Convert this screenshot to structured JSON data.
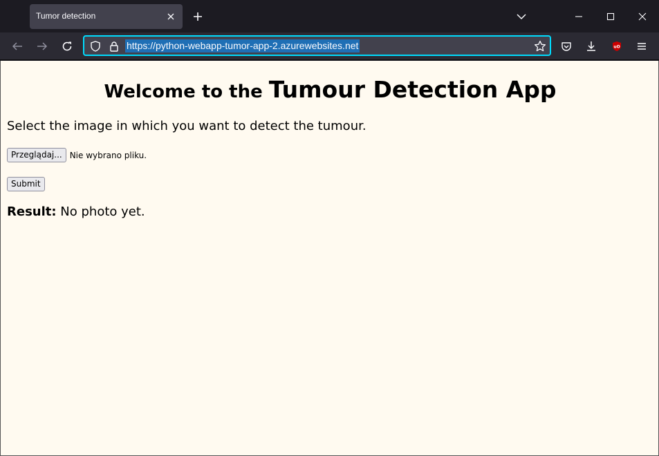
{
  "browser": {
    "tab_title": "Tumor detection",
    "url": "https://python-webapp-tumor-app-2.azurewebsites.net",
    "colors": {
      "tabbar": "#1c1b22",
      "navbar": "#2b2a33",
      "urlbar": "#42414d",
      "focus_ring": "#00ddff",
      "ublock_red": "#cc0000"
    },
    "icons": [
      "close-icon",
      "plus-icon",
      "chevron-down-icon",
      "minimize-icon",
      "maximize-icon",
      "window-close-icon",
      "back-arrow-icon",
      "forward-arrow-icon",
      "reload-icon",
      "shield-icon",
      "lock-icon",
      "star-icon",
      "pocket-icon",
      "download-icon",
      "ublock-icon",
      "menu-icon"
    ]
  },
  "page": {
    "heading_prefix": "Welcome to the ",
    "heading_main": "Tumour Detection App",
    "intro": "Select the image in which you want to detect the tumour.",
    "browse_label": "Przeglądaj...",
    "no_file_text": "Nie wybrano pliku.",
    "submit_label": "Submit",
    "result_label": "Result:",
    "result_value": " No photo yet.",
    "background": "#fffaf0"
  }
}
